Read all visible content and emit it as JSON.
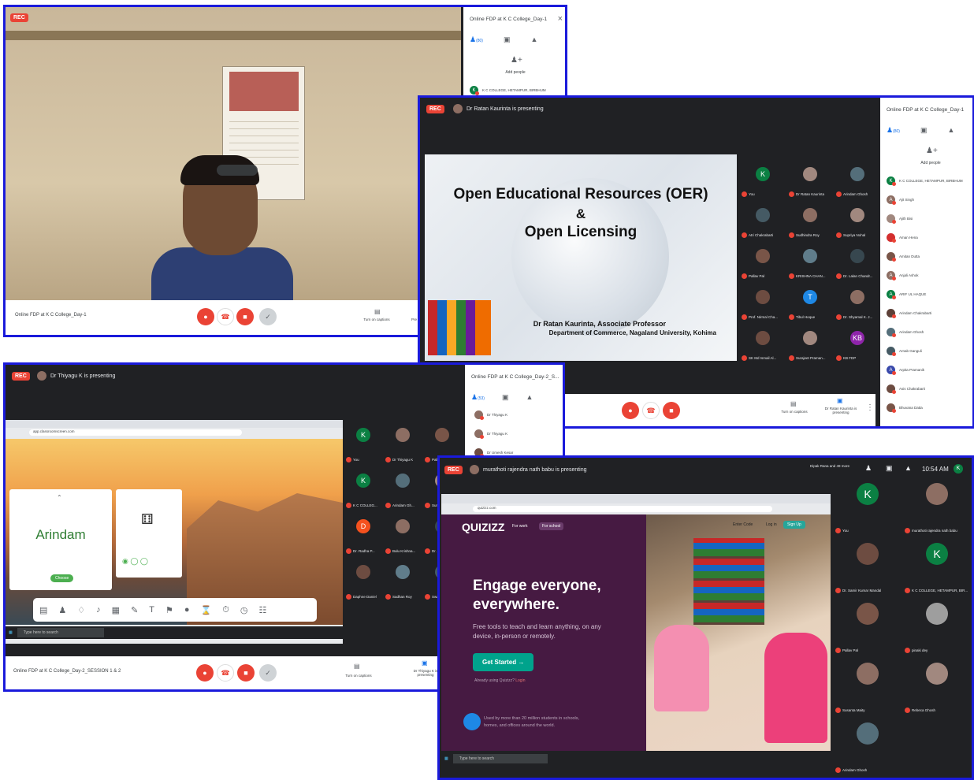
{
  "s1": {
    "rec": "REC",
    "side_title": "Online FDP at K C College_Day-1",
    "close": "×",
    "people_count": "(80)",
    "add_people": "Add people",
    "participant": "K C COLLEGE, HETAMPUR, BIRBHUM",
    "meeting_name": "Online FDP at K C College_Day-1",
    "captions": "Turn on captions",
    "pres_cut": "Pre"
  },
  "s2": {
    "rec": "REC",
    "presenting": "Dr Ratan Kaurinta is presenting",
    "slide_title_1": "Open Educational Resources (OER)",
    "slide_amp": "&",
    "slide_title_2": "Open Licensing",
    "slide_author": "Dr Ratan Kaurinta, Associate Professor",
    "slide_dept": "Department of Commerce, Nagaland University, Kohima",
    "side_title": "Online FDP at K C College_Day-1",
    "people_count": "(80)",
    "add_people": "Add people",
    "tiles": [
      {
        "name": "You",
        "initial": "K",
        "color": "#0b8043"
      },
      {
        "name": "Dr Ratan Kaurinta",
        "initial": "",
        "color": "#a1887f"
      },
      {
        "name": "Arindam Ghosh",
        "initial": "",
        "color": "#546e7a"
      },
      {
        "name": "Atri Chakrabarti",
        "initial": "",
        "color": "#455a64"
      },
      {
        "name": "Sudhindra Roy",
        "initial": "",
        "color": "#8d6e63"
      },
      {
        "name": "Supriya Nohal",
        "initial": "",
        "color": "#a1887f"
      },
      {
        "name": "Pallav Pal",
        "initial": "",
        "color": "#795548"
      },
      {
        "name": "KRISHNA CHAN...",
        "initial": "",
        "color": "#607d8b"
      },
      {
        "name": "Dr. Lalan Chandr...",
        "initial": "",
        "color": "#37474f"
      },
      {
        "name": "Prof. Nirmal Cha...",
        "initial": "",
        "color": "#6d4c41"
      },
      {
        "name": "Tibul Hoque",
        "initial": "T",
        "color": "#1e88e5"
      },
      {
        "name": "Dr. Shyamal K. J...",
        "initial": "",
        "color": "#8d6e63"
      },
      {
        "name": "SK Md Ismail Al...",
        "initial": "",
        "color": "#6d4c41"
      },
      {
        "name": "Surajeet Praman...",
        "initial": "",
        "color": "#a1887f"
      },
      {
        "name": "KB FDP",
        "initial": "KB",
        "color": "#8e24aa"
      }
    ],
    "participants": [
      {
        "name": "K C COLLEGE, HETAMPUR, BIRBHUM",
        "initial": "K",
        "color": "#0b8043"
      },
      {
        "name": "Ajit Singh",
        "initial": "A",
        "color": "#8d6e63"
      },
      {
        "name": "Ajith Bisi",
        "initial": "",
        "color": "#a1887f"
      },
      {
        "name": "Aman Hena",
        "initial": "",
        "color": "#d32f2f"
      },
      {
        "name": "Amitan Dutta",
        "initial": "",
        "color": "#795548"
      },
      {
        "name": "Anjali Ashok",
        "initial": "A",
        "color": "#8d6e63"
      },
      {
        "name": "ARIF UL HAQUE",
        "initial": "A",
        "color": "#0b8043"
      },
      {
        "name": "Arindam Chakrabarti",
        "initial": "",
        "color": "#5d4037"
      },
      {
        "name": "Arindam Ghosh",
        "initial": "",
        "color": "#546e7a"
      },
      {
        "name": "Arnab Ganguli",
        "initial": "",
        "color": "#455a64"
      },
      {
        "name": "Arpita Pramanik",
        "initial": "A",
        "color": "#3949ab"
      },
      {
        "name": "Asis Chakrabarti",
        "initial": "",
        "color": "#6d4c41"
      },
      {
        "name": "Bhuvana Datta",
        "initial": "",
        "color": "#795548"
      }
    ],
    "captions": "Turn on captions",
    "presenting_caption": "Dr Ratan Kaurinta is presenting"
  },
  "s3": {
    "rec": "REC",
    "presenting": "Dr Thiyagu K is presenting",
    "side_title": "Online FDP at K C College_Day-2_S...",
    "people_count": "(53)",
    "participants": [
      "Dr Thiyagu K",
      "Dr Thiyagu K",
      "Dr Umesh Kesar"
    ],
    "url": "app.classroomscreen.com",
    "card_name": "Arindam",
    "choose": "Choose",
    "search_placeholder": "Type here to search",
    "meeting_name": "Online FDP at K C College_Day-2_SESSION 1 & 2",
    "captions": "Turn on captions",
    "presenting_caption": "Dr Thiyagu K is presenting",
    "tiles": [
      {
        "name": "You",
        "initial": "K",
        "color": "#0b8043"
      },
      {
        "name": "Dr Thiyagu K",
        "initial": "",
        "color": "#8d6e63"
      },
      {
        "name": "Pallav Pal",
        "initial": "",
        "color": "#795548"
      },
      {
        "name": "K C COLLEG...",
        "initial": "K",
        "color": "#0b8043"
      },
      {
        "name": "Arindam Gh...",
        "initial": "",
        "color": "#546e7a"
      },
      {
        "name": "Surajeet Pra...",
        "initial": "",
        "color": "#a1887f"
      },
      {
        "name": "Dr. Radha P...",
        "initial": "D",
        "color": "#f4511e"
      },
      {
        "name": "Bulu Krishna...",
        "initial": "",
        "color": "#8d6e63"
      },
      {
        "name": "Dr. Lalan Ch...",
        "initial": "",
        "color": "#37474f"
      },
      {
        "name": "Daphne Daniel",
        "initial": "",
        "color": "#6d4c41"
      },
      {
        "name": "Sadhan Roy",
        "initial": "",
        "color": "#607d8b"
      },
      {
        "name": "Swasti Sharma",
        "initial": "",
        "color": "#455a64"
      }
    ]
  },
  "s4": {
    "rec": "REC",
    "presenting": "murathoti rajendra nath babu is presenting",
    "others": "Dipak Rana and 49 more",
    "time": "10:54 AM",
    "url": "quizizz.com",
    "brand": "QUIZIZZ",
    "nav_work": "For work",
    "nav_school": "For school",
    "enter_code": "Enter Code",
    "login": "Log in",
    "signup": "Sign Up",
    "headline_1": "Engage everyone,",
    "headline_2": "everywhere.",
    "sub_1": "Free tools to teach and learn anything, on any",
    "sub_2": "device, in-person or remotely.",
    "cta": "Get Started",
    "already": "Already using Quizizz?",
    "login_link": "Login",
    "used_by_1": "Used by more than 20 million students in schools,",
    "used_by_2": "homes, and offices around the world.",
    "search_placeholder": "Type here to search",
    "tiles": [
      {
        "name": "You",
        "initial": "K",
        "color": "#0b8043"
      },
      {
        "name": "murathoti rajendra nath babu",
        "initial": "",
        "color": "#8d6e63"
      },
      {
        "name": "Dr. Samir Kumar Mandal",
        "initial": "",
        "color": "#6d4c41"
      },
      {
        "name": "K C COLLEGE, HETAMPUR, BIR...",
        "initial": "K",
        "color": "#0b8043"
      },
      {
        "name": "Pallav Pal",
        "initial": "",
        "color": "#795548"
      },
      {
        "name": "pinaki dey",
        "initial": "",
        "color": "#9e9e9e"
      },
      {
        "name": "Susanta Maity",
        "initial": "",
        "color": "#8d6e63"
      },
      {
        "name": "Rebeca Ghosh",
        "initial": "",
        "color": "#a1887f"
      },
      {
        "name": "Arindam Ghosh",
        "initial": "",
        "color": "#546e7a"
      }
    ]
  }
}
